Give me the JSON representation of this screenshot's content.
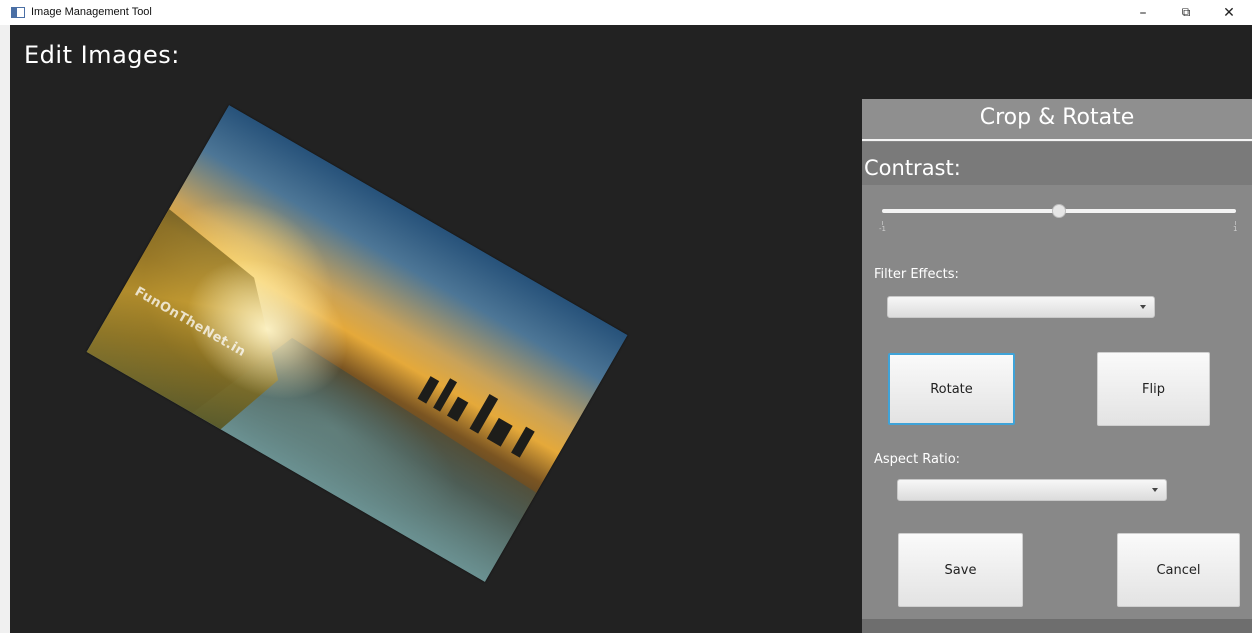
{
  "window": {
    "title": "Image Management Tool",
    "controls": {
      "minimize": "–",
      "maximize": "⧉",
      "close": "✕"
    }
  },
  "main": {
    "heading": "Edit Images:",
    "image": {
      "watermark": "FunOnTheNet.in"
    }
  },
  "panel": {
    "title": "Crop & Rotate",
    "contrast": {
      "label": "Contrast:",
      "min_label": "-1",
      "max_label": "1",
      "value": 0
    },
    "filter_effects": {
      "label": "Filter Effects:",
      "selected": ""
    },
    "rotate_button": "Rotate",
    "flip_button": "Flip",
    "aspect_ratio": {
      "label": "Aspect Ratio:",
      "selected": ""
    },
    "save_button": "Save",
    "cancel_button": "Cancel"
  },
  "colors": {
    "background": "#222222",
    "panel": "#888888",
    "panel_header": "#8f8f8f",
    "focus_ring": "#3fa3d8"
  }
}
